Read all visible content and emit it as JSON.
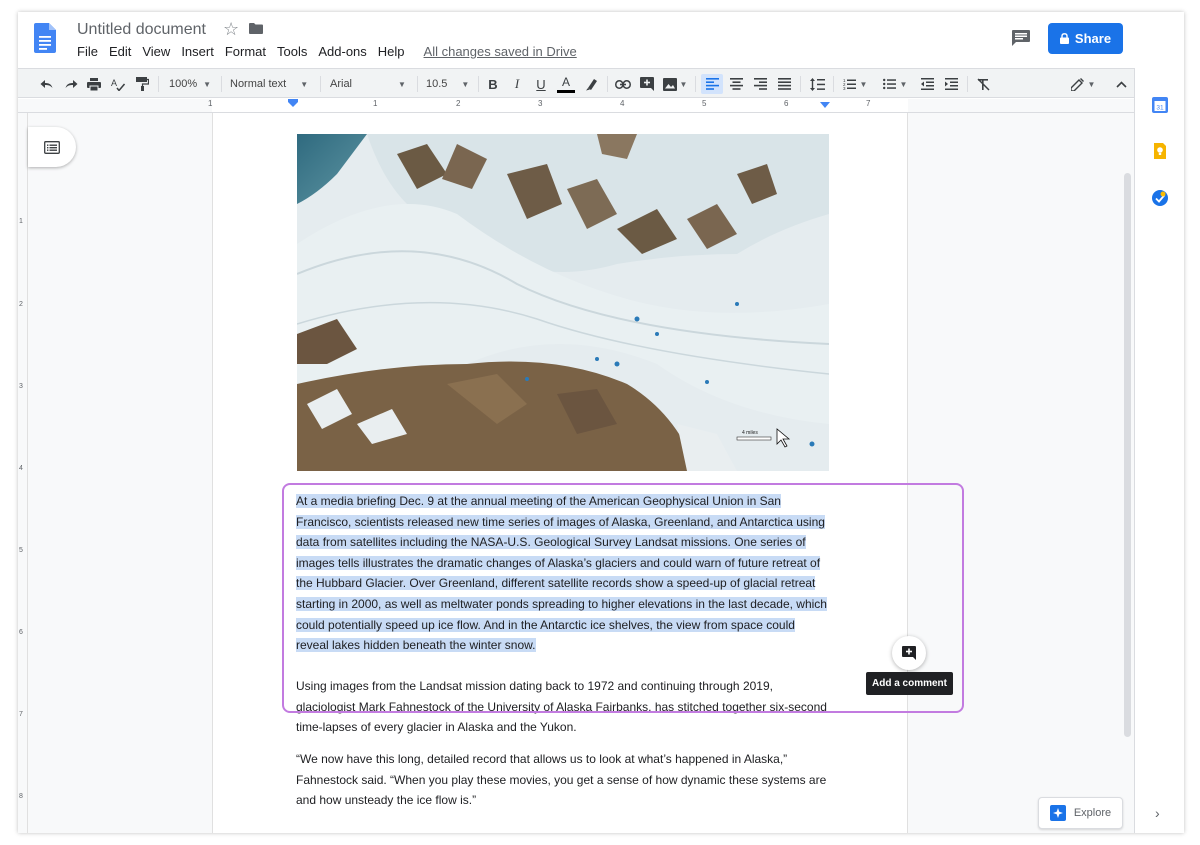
{
  "header": {
    "title": "Untitled document",
    "menu": [
      "File",
      "Edit",
      "View",
      "Insert",
      "Format",
      "Tools",
      "Add-ons",
      "Help"
    ],
    "save_status": "All changes saved in Drive",
    "share_label": "Share"
  },
  "toolbar": {
    "zoom": "100%",
    "style": "Normal text",
    "font": "Arial",
    "font_size": "10.5",
    "icons": [
      "undo-icon",
      "redo-icon",
      "print-icon",
      "spellcheck-icon",
      "paint-format-icon",
      "bold-icon",
      "italic-icon",
      "underline-icon",
      "text-color-icon",
      "highlight-icon",
      "link-icon",
      "insert-comment-icon",
      "insert-image-icon",
      "align-left-icon",
      "align-center-icon",
      "align-right-icon",
      "justify-icon",
      "line-spacing-icon",
      "numbered-list-icon",
      "bulleted-list-icon",
      "decrease-indent-icon",
      "increase-indent-icon",
      "clear-formatting-icon",
      "editing-mode-icon",
      "collapse-icon"
    ]
  },
  "ruler": {
    "labels": [
      "1",
      "1",
      "2",
      "3",
      "4",
      "5",
      "6",
      "7"
    ]
  },
  "vertical_ruler": {
    "labels": [
      "1",
      "2",
      "3",
      "4",
      "5",
      "6",
      "7",
      "8"
    ]
  },
  "image": {
    "scale_label": "4 miles"
  },
  "document": {
    "paragraph1": [
      "At a media briefing Dec. 9 at the annual meeting of the American Geophysical Union in San",
      "Francisco, scientists released new time series of images of Alaska, Greenland, and Antarctica using",
      "data from satellites including the NASA-U.S. Geological Survey Landsat missions. One series of",
      "images tells illustrates the dramatic changes of Alaska’s glaciers and could warn of future retreat of",
      "the Hubbard Glacier. Over Greenland, different satellite records show a speed-up of glacial retreat",
      "starting in 2000, as well as meltwater ponds spreading to higher elevations in the last decade, which",
      "could potentially speed up ice flow. And in the Antarctic ice shelves, the view from space could",
      "reveal lakes hidden beneath the winter snow."
    ],
    "paragraph2": [
      "Using images from the Landsat mission dating back to 1972 and continuing through 2019,",
      "glaciologist Mark Fahnestock of the University of Alaska Fairbanks, has stitched together six-second",
      "time-lapses of every glacier in Alaska and the Yukon."
    ],
    "paragraph3": [
      "“We now have this long, detailed record that allows us to look at what’s happened in Alaska,”",
      "Fahnestock said. “When you play these movies, you get a sense of how dynamic these systems are",
      "and how unsteady the ice flow is.”"
    ]
  },
  "comment": {
    "tooltip": "Add a comment"
  },
  "explore": {
    "label": "Explore"
  },
  "side_panel": {
    "icons": [
      "calendar-icon",
      "keep-icon",
      "tasks-icon"
    ],
    "calendar_day": "31"
  },
  "colors": {
    "accent": "#1a73e8",
    "selection": "#c8dbf5",
    "focus_box": "#c27be0"
  }
}
